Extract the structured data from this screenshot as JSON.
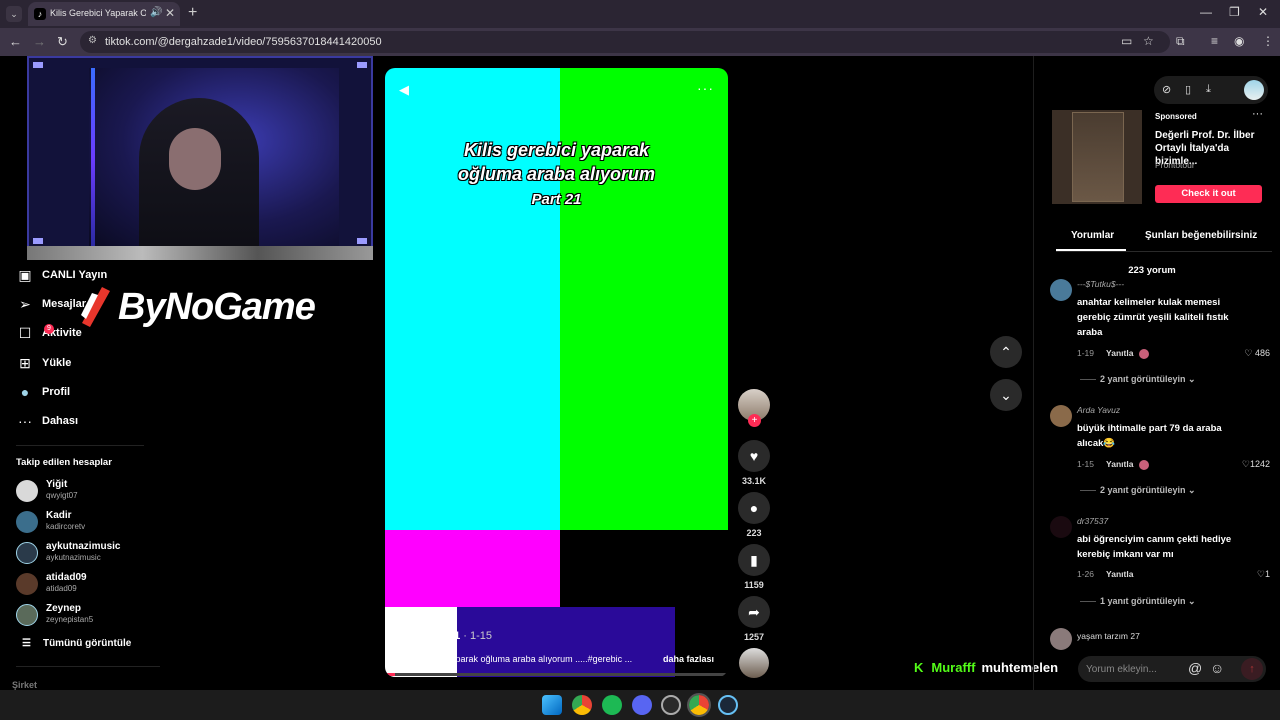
{
  "browser": {
    "tab_title": "Kilis Gerebici Yaparak Oğlu",
    "url": "tiktok.com/@dergahzade1/video/7595637018441420050",
    "tab_menu_icon": "chevron-down-icon",
    "audio_icon": "speaker-icon",
    "close_glyph": "✕",
    "new_tab_glyph": "+",
    "back_glyph": "←",
    "forward_glyph": "→",
    "reload_glyph": "↻",
    "minimize_glyph": "—",
    "restore_glyph": "❐",
    "close_window_glyph": "✕"
  },
  "sidebar": {
    "items": [
      {
        "label": "CANLI Yayın",
        "icon": "live-icon",
        "glyph": "▣"
      },
      {
        "label": "Mesajlar",
        "icon": "paper-plane-icon",
        "glyph": "➢"
      },
      {
        "label": "Aktivite",
        "icon": "activity-icon",
        "glyph": "☐",
        "badge": "9"
      },
      {
        "label": "Yükle",
        "icon": "upload-icon",
        "glyph": "⊞"
      },
      {
        "label": "Profil",
        "icon": "profile-avatar-icon",
        "glyph": "●"
      },
      {
        "label": "Dahası",
        "icon": "more-icon",
        "glyph": "···"
      }
    ],
    "following_header": "Takip edilen hesaplar",
    "following": [
      {
        "name": "Yiğit",
        "handle": "qwyigt07",
        "color": "#d9d9d9"
      },
      {
        "name": "Kadir",
        "handle": "kadircoretv",
        "color": "#3b6e8c"
      },
      {
        "name": "aykutnazimusic",
        "handle": "aykutnazimusic",
        "color": "#2a3a4a"
      },
      {
        "name": "atidad09",
        "handle": "atidad09",
        "color": "#5a3a2a"
      },
      {
        "name": "Zeynep",
        "handle": "zeynepistan5",
        "color": "#5a6a5a"
      }
    ],
    "see_all": "Tümünü görüntüle",
    "see_all_icon": "list-icon",
    "footer_label": "Şirket"
  },
  "overlay": {
    "logo_text": "ByNoGame"
  },
  "video": {
    "title_line1": "Kilis gerebici yaparak",
    "title_line2": "oğluma araba alıyorum",
    "title_line3": "Part 21",
    "author": "dergahzade1",
    "date": " · 1-15",
    "description": "Kilis gerebici yaparak oğluma araba alıyorum .....#gerebic ...",
    "more_label": "daha fazlası",
    "progress": 0.03,
    "colors": {
      "cyan": "#00ffff",
      "green": "#00ff00",
      "magenta": "#ff00ff",
      "white": "#ffffff",
      "blue": "#2a0a99",
      "accent": "#fe2c55"
    }
  },
  "actions": {
    "likes": "33.1K",
    "comments": "223",
    "saves": "1159",
    "shares": "1257"
  },
  "panel": {
    "ad": {
      "sponsored": "Sponsored",
      "title": "Değerli Prof. Dr. İlber Ortaylı İtalya'da bizimle...",
      "brand": "Prontotour",
      "cta": "Check it out"
    },
    "tabs": [
      "Yorumlar",
      "Şunları beğenebilirsiniz"
    ],
    "comment_count": "223 yorum",
    "comments": [
      {
        "user": "---$Tutku$---",
        "text": "anahtar kelimeler kulak memesi gerebiç zümrüt yeşili kaliteli fıstık araba",
        "date": "1-19",
        "reply": "Yanıtla",
        "likes": "486",
        "more": "2 yanıt görüntüleyin",
        "color": "#4a7a9a"
      },
      {
        "user": "Arda Yavuz",
        "text": "büyük ihtimalle part 79 da araba alıcak😂",
        "date": "1-15",
        "reply": "Yanıtla",
        "likes": "1242",
        "more": "2 yanıt görüntüleyin",
        "color": "#8a6a4a"
      },
      {
        "user": "dr37537",
        "text": "abi öğrenciyim canım çekti hediye kerebiç imkanı var mı",
        "date": "1-26",
        "reply": "Yanıtla",
        "likes": "1",
        "more": "1 yanıt görüntüleyin",
        "color": "#1a0a10"
      },
      {
        "user": "yaşam tarzım 27",
        "color": "#8a7a7a"
      }
    ],
    "input_placeholder": "Yorum ekleyin..."
  },
  "stream": {
    "platform_mark": "K",
    "user": "Murafff",
    "text": "muhtemelen"
  }
}
